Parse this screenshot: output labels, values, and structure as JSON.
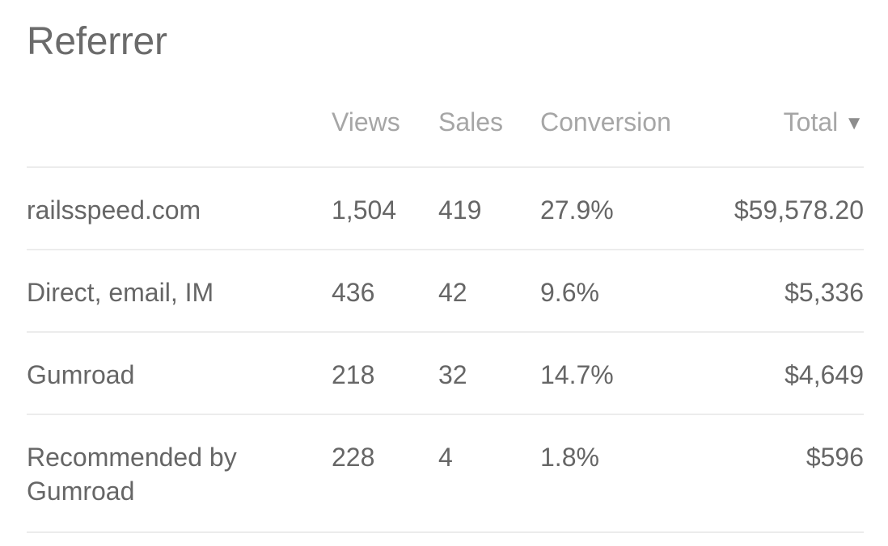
{
  "title": "Referrer",
  "columns": {
    "referrer": "",
    "views": "Views",
    "sales": "Sales",
    "conversion": "Conversion",
    "total": "Total",
    "sort_indicator": "▼"
  },
  "rows": [
    {
      "referrer": "railsspeed.com",
      "views": "1,504",
      "sales": "419",
      "conversion": "27.9%",
      "total": "$59,578.20"
    },
    {
      "referrer": "Direct, email, IM",
      "views": "436",
      "sales": "42",
      "conversion": "9.6%",
      "total": "$5,336"
    },
    {
      "referrer": "Gumroad",
      "views": "218",
      "sales": "32",
      "conversion": "14.7%",
      "total": "$4,649"
    },
    {
      "referrer": "Recommended by Gumroad",
      "views": "228",
      "sales": "4",
      "conversion": "1.8%",
      "total": "$596"
    }
  ]
}
